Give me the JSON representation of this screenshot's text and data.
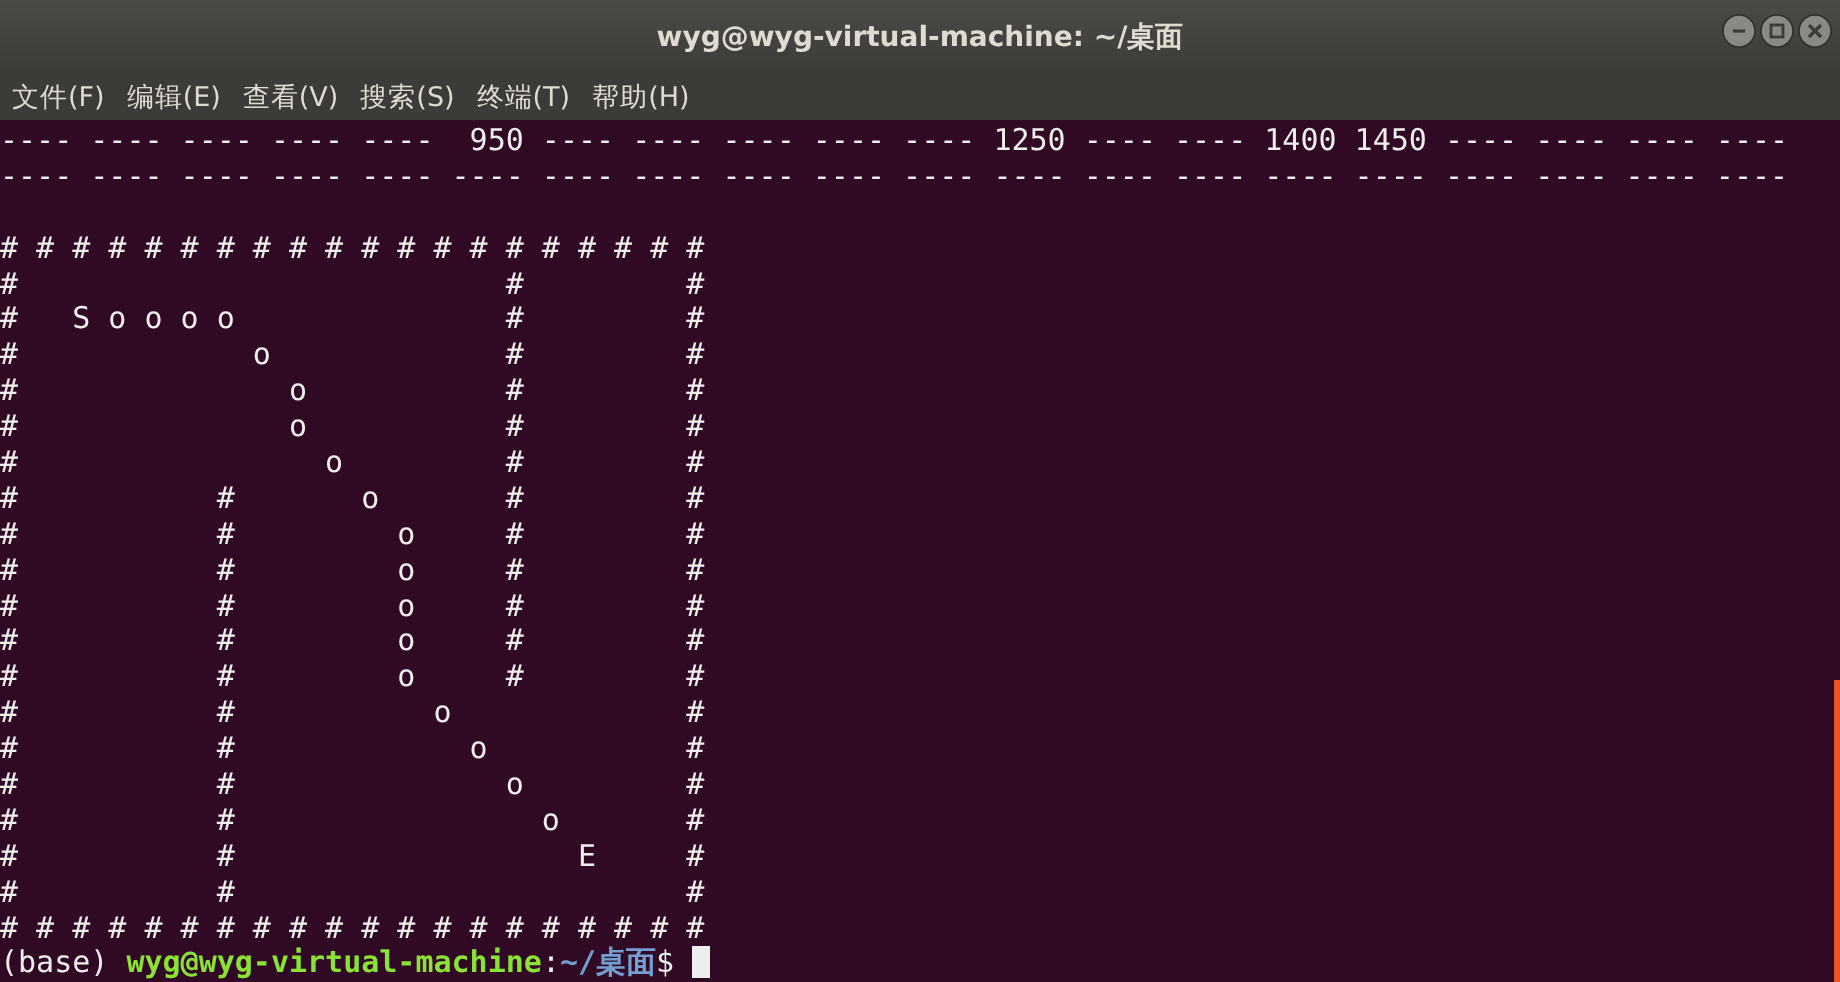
{
  "window": {
    "title": "wyg@wyg-virtual-machine: ~/桌面"
  },
  "menu": [
    "文件(F)",
    "编辑(E)",
    "查看(V)",
    "搜索(S)",
    "终端(T)",
    "帮助(H)"
  ],
  "terminal": {
    "lines": [
      {
        "kind": "output",
        "text": "---- ---- ---- ---- ----  950 ---- ---- ---- ---- ---- 1250 ---- ---- 1400 1450 ---- ---- ---- ----"
      },
      {
        "kind": "output",
        "text": "---- ---- ---- ---- ---- ---- ---- ---- ---- ---- ---- ---- ---- ---- ---- ---- ---- ---- ---- ----"
      },
      {
        "kind": "blank"
      },
      {
        "kind": "output",
        "text": "# # # # # # # # # # # # # # # # # # # #"
      },
      {
        "kind": "output",
        "text": "#                           #         #"
      },
      {
        "kind": "output",
        "text": "#   S o o o o               #         #"
      },
      {
        "kind": "output",
        "text": "#             o             #         #"
      },
      {
        "kind": "output",
        "text": "#               o           #         #"
      },
      {
        "kind": "output",
        "text": "#               o           #         #"
      },
      {
        "kind": "output",
        "text": "#                 o         #         #"
      },
      {
        "kind": "output",
        "text": "#           #       o       #         #"
      },
      {
        "kind": "output",
        "text": "#           #         o     #         #"
      },
      {
        "kind": "output",
        "text": "#           #         o     #         #"
      },
      {
        "kind": "output",
        "text": "#           #         o     #         #"
      },
      {
        "kind": "output",
        "text": "#           #         o     #         #"
      },
      {
        "kind": "output",
        "text": "#           #         o     #         #"
      },
      {
        "kind": "output",
        "text": "#           #           o             #"
      },
      {
        "kind": "output",
        "text": "#           #             o           #"
      },
      {
        "kind": "output",
        "text": "#           #               o         #"
      },
      {
        "kind": "output",
        "text": "#           #                 o       #"
      },
      {
        "kind": "output",
        "text": "#           #                   E     #"
      },
      {
        "kind": "output",
        "text": "#           #                         #"
      },
      {
        "kind": "output",
        "text": "# # # # # # # # # # # # # # # # # # # #"
      },
      {
        "kind": "prompt",
        "env": "(base)",
        "user_host": "wyg@wyg-virtual-machine",
        "separator": ":",
        "path": "~/桌面",
        "symbol": "$"
      }
    ]
  }
}
